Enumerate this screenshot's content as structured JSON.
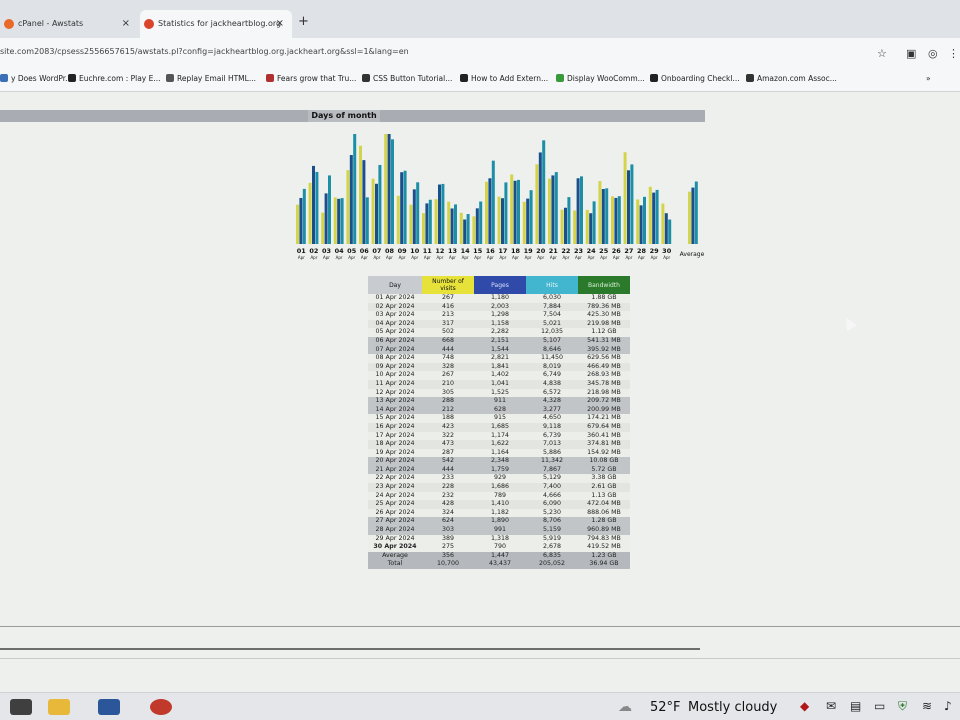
{
  "browser": {
    "tabs": [
      {
        "label": "cPanel - Awstats",
        "favicon_color": "#e8692a"
      },
      {
        "label": "Statistics for jackheartblog.org",
        "favicon_color": "#d9442b"
      }
    ],
    "new_tab_glyph": "+",
    "close_glyph": "×",
    "url": "site.com2083/cpsess2556657615/awstats.pl?config=jackheartblog.org.jackheart.org&ssl=1&lang=en",
    "toolbar_icons": [
      "star-icon",
      "extension-icon",
      "profile-icon",
      "menu-icon"
    ],
    "bookmarks": [
      {
        "label": "y Does WordPr...",
        "color": "#3b6fb6"
      },
      {
        "label": "Euchre.com : Play E...",
        "color": "#222222"
      },
      {
        "label": "Replay Email HTML...",
        "color": "#555555"
      },
      {
        "label": "Fears grow that Tru...",
        "color": "#b03030"
      },
      {
        "label": "CSS Button Tutorial...",
        "color": "#333333"
      },
      {
        "label": "How to Add Extern...",
        "color": "#222222"
      },
      {
        "label": "Display WooComm...",
        "color": "#3a9a3a"
      },
      {
        "label": "Onboarding Checkl...",
        "color": "#222222"
      },
      {
        "label": "Amazon.com Assoc...",
        "color": "#333333"
      }
    ],
    "overflow_glyph": "»"
  },
  "section": {
    "title": "Days of month"
  },
  "chart_data": {
    "type": "bar",
    "categories": [
      "01",
      "02",
      "03",
      "04",
      "05",
      "06",
      "07",
      "08",
      "09",
      "10",
      "11",
      "12",
      "13",
      "14",
      "15",
      "16",
      "17",
      "18",
      "19",
      "20",
      "21",
      "22",
      "23",
      "24",
      "25",
      "26",
      "27",
      "28",
      "29",
      "30"
    ],
    "month_label": "Apr",
    "average_label": "Average",
    "series": [
      {
        "name": "Number of visits",
        "color": "#d4d44a",
        "values": [
          267,
          416,
          213,
          317,
          502,
          668,
          444,
          748,
          328,
          267,
          210,
          305,
          288,
          212,
          188,
          423,
          322,
          473,
          287,
          542,
          444,
          233,
          228,
          232,
          428,
          324,
          624,
          303,
          389,
          275
        ]
      },
      {
        "name": "Pages",
        "color": "#1a4f8c",
        "values": [
          1180,
          2003,
          1298,
          1158,
          2282,
          2151,
          1544,
          2821,
          1841,
          1402,
          1041,
          1525,
          911,
          628,
          915,
          1685,
          1174,
          1622,
          1164,
          2348,
          1759,
          929,
          1686,
          789,
          1410,
          1182,
          1890,
          991,
          1318,
          790
        ]
      },
      {
        "name": "Hits",
        "color": "#1b8fa6",
        "values": [
          6030,
          7884,
          7504,
          5021,
          12035,
          5107,
          8646,
          11450,
          8019,
          6749,
          4838,
          6572,
          4328,
          3277,
          4650,
          9118,
          6739,
          7013,
          5886,
          11342,
          7867,
          5129,
          7400,
          4666,
          6090,
          5230,
          8706,
          5159,
          5919,
          2678
        ]
      }
    ],
    "averages": {
      "visits": 356,
      "pages": 1447,
      "hits": 6835
    }
  },
  "table": {
    "headers": {
      "day": "Day",
      "visits": "Number of visits",
      "pages": "Pages",
      "hits": "Hits",
      "bandwidth": "Bandwidth"
    },
    "rows": [
      {
        "day": "01 Apr 2024",
        "visits": "267",
        "pages": "1,180",
        "hits": "6,030",
        "bandwidth": "1.88 GB",
        "kind": "odd"
      },
      {
        "day": "02 Apr 2024",
        "visits": "416",
        "pages": "2,003",
        "hits": "7,884",
        "bandwidth": "789.36 MB",
        "kind": "even"
      },
      {
        "day": "03 Apr 2024",
        "visits": "213",
        "pages": "1,298",
        "hits": "7,504",
        "bandwidth": "425.30 MB",
        "kind": "odd"
      },
      {
        "day": "04 Apr 2024",
        "visits": "317",
        "pages": "1,158",
        "hits": "5,021",
        "bandwidth": "219.98 MB",
        "kind": "even"
      },
      {
        "day": "05 Apr 2024",
        "visits": "502",
        "pages": "2,282",
        "hits": "12,035",
        "bandwidth": "1.12 GB",
        "kind": "odd"
      },
      {
        "day": "06 Apr 2024",
        "visits": "668",
        "pages": "2,151",
        "hits": "5,107",
        "bandwidth": "541.31 MB",
        "kind": "we"
      },
      {
        "day": "07 Apr 2024",
        "visits": "444",
        "pages": "1,544",
        "hits": "8,646",
        "bandwidth": "395.92 MB",
        "kind": "we"
      },
      {
        "day": "08 Apr 2024",
        "visits": "748",
        "pages": "2,821",
        "hits": "11,450",
        "bandwidth": "629.56 MB",
        "kind": "odd"
      },
      {
        "day": "09 Apr 2024",
        "visits": "328",
        "pages": "1,841",
        "hits": "8,019",
        "bandwidth": "466.49 MB",
        "kind": "even"
      },
      {
        "day": "10 Apr 2024",
        "visits": "267",
        "pages": "1,402",
        "hits": "6,749",
        "bandwidth": "268.93 MB",
        "kind": "odd"
      },
      {
        "day": "11 Apr 2024",
        "visits": "210",
        "pages": "1,041",
        "hits": "4,838",
        "bandwidth": "345.78 MB",
        "kind": "even"
      },
      {
        "day": "12 Apr 2024",
        "visits": "305",
        "pages": "1,525",
        "hits": "6,572",
        "bandwidth": "218.98 MB",
        "kind": "odd"
      },
      {
        "day": "13 Apr 2024",
        "visits": "288",
        "pages": "911",
        "hits": "4,328",
        "bandwidth": "209.72 MB",
        "kind": "we"
      },
      {
        "day": "14 Apr 2024",
        "visits": "212",
        "pages": "628",
        "hits": "3,277",
        "bandwidth": "200.99 MB",
        "kind": "we"
      },
      {
        "day": "15 Apr 2024",
        "visits": "188",
        "pages": "915",
        "hits": "4,650",
        "bandwidth": "174.21 MB",
        "kind": "odd"
      },
      {
        "day": "16 Apr 2024",
        "visits": "423",
        "pages": "1,685",
        "hits": "9,118",
        "bandwidth": "679.64 MB",
        "kind": "even"
      },
      {
        "day": "17 Apr 2024",
        "visits": "322",
        "pages": "1,174",
        "hits": "6,739",
        "bandwidth": "360.41 MB",
        "kind": "odd"
      },
      {
        "day": "18 Apr 2024",
        "visits": "473",
        "pages": "1,622",
        "hits": "7,013",
        "bandwidth": "374.81 MB",
        "kind": "even"
      },
      {
        "day": "19 Apr 2024",
        "visits": "287",
        "pages": "1,164",
        "hits": "5,886",
        "bandwidth": "154.92 MB",
        "kind": "odd"
      },
      {
        "day": "20 Apr 2024",
        "visits": "542",
        "pages": "2,348",
        "hits": "11,342",
        "bandwidth": "10.08 GB",
        "kind": "we"
      },
      {
        "day": "21 Apr 2024",
        "visits": "444",
        "pages": "1,759",
        "hits": "7,867",
        "bandwidth": "5.72 GB",
        "kind": "we"
      },
      {
        "day": "22 Apr 2024",
        "visits": "233",
        "pages": "929",
        "hits": "5,129",
        "bandwidth": "3.38 GB",
        "kind": "odd"
      },
      {
        "day": "23 Apr 2024",
        "visits": "228",
        "pages": "1,686",
        "hits": "7,400",
        "bandwidth": "2.61 GB",
        "kind": "even"
      },
      {
        "day": "24 Apr 2024",
        "visits": "232",
        "pages": "789",
        "hits": "4,666",
        "bandwidth": "1.13 GB",
        "kind": "odd"
      },
      {
        "day": "25 Apr 2024",
        "visits": "428",
        "pages": "1,410",
        "hits": "6,090",
        "bandwidth": "472.04 MB",
        "kind": "even"
      },
      {
        "day": "26 Apr 2024",
        "visits": "324",
        "pages": "1,182",
        "hits": "5,230",
        "bandwidth": "888.06 MB",
        "kind": "odd"
      },
      {
        "day": "27 Apr 2024",
        "visits": "624",
        "pages": "1,890",
        "hits": "8,706",
        "bandwidth": "1.28 GB",
        "kind": "we"
      },
      {
        "day": "28 Apr 2024",
        "visits": "303",
        "pages": "991",
        "hits": "5,159",
        "bandwidth": "960.89 MB",
        "kind": "we"
      },
      {
        "day": "29 Apr 2024",
        "visits": "389",
        "pages": "1,318",
        "hits": "5,919",
        "bandwidth": "794.83 MB",
        "kind": "odd"
      },
      {
        "day": "30 Apr 2024",
        "visits": "275",
        "pages": "790",
        "hits": "2,678",
        "bandwidth": "419.52 MB",
        "kind": "bold"
      }
    ],
    "average": {
      "day": "Average",
      "visits": "356",
      "pages": "1,447",
      "hits": "6,835",
      "bandwidth": "1.23 GB"
    },
    "total": {
      "day": "Total",
      "visits": "10,700",
      "pages": "43,437",
      "hits": "205,052",
      "bandwidth": "36.94 GB"
    }
  },
  "taskbar": {
    "apps": [
      {
        "name": "file-explorer-icon",
        "color": "#e8b83a"
      },
      {
        "name": "word-icon",
        "color": "#2b579a"
      },
      {
        "name": "headset-icon",
        "color": "#c0392b"
      }
    ],
    "weather_temp": "52°F",
    "weather_desc": "Mostly cloudy"
  }
}
